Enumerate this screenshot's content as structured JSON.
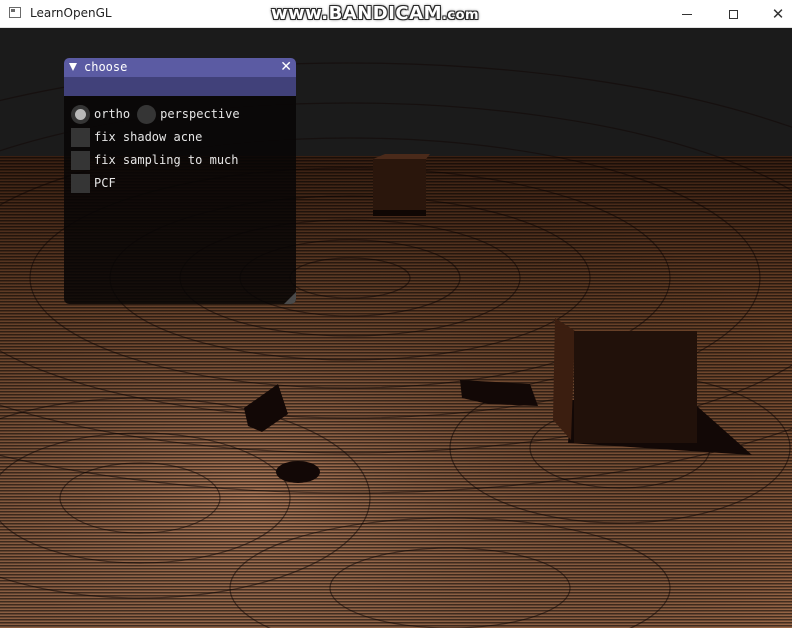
{
  "window": {
    "title": "LearnOpenGL",
    "watermark_main": "www.BANDICAM",
    "watermark_suffix": ".com"
  },
  "imgui": {
    "title": "choose",
    "close_glyph": "✕",
    "projection_options": [
      {
        "label": "ortho",
        "selected": true
      },
      {
        "label": "perspective",
        "selected": false
      }
    ],
    "checkboxes": [
      {
        "label": "fix shadow acne",
        "checked": false
      },
      {
        "label": "fix sampling to much",
        "checked": false
      },
      {
        "label": "PCF",
        "checked": false
      }
    ]
  },
  "colors": {
    "imgui_title_active": "#5b5ba3",
    "imgui_menubar": "#41417a",
    "floor_light": "#b27a55",
    "floor_dark": "#140a06",
    "sky": "#1b1b1b"
  },
  "icons": {
    "app": "window-icon",
    "minimize": "minimize-icon",
    "maximize": "maximize-icon",
    "close": "close-icon",
    "collapse": "triangle-down-icon",
    "imgui_close": "close-icon",
    "resize": "resize-grip-icon"
  }
}
